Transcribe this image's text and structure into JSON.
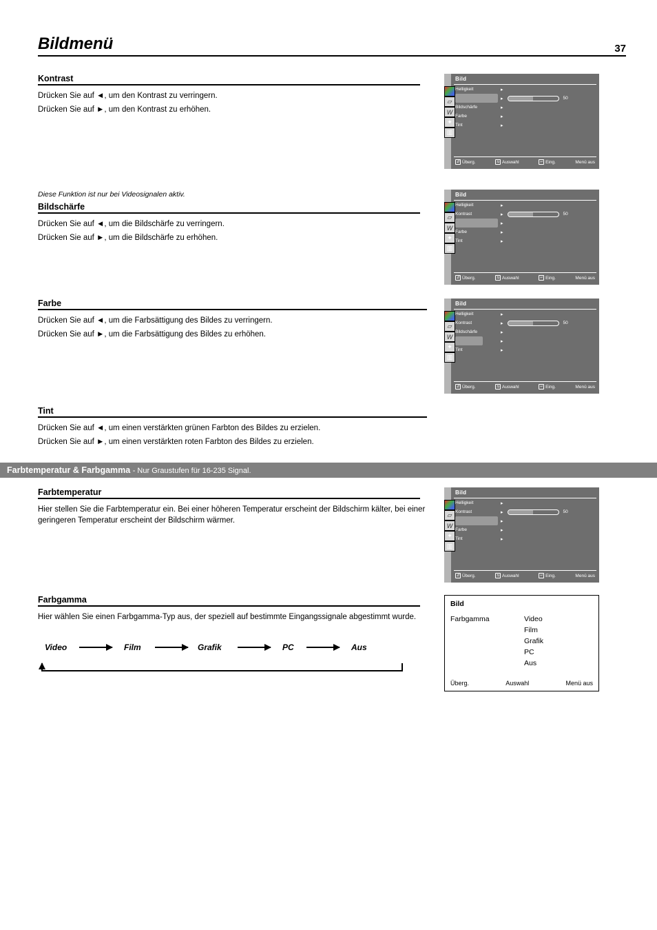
{
  "heading": "Bildmenü",
  "page_number": "37",
  "sections": {
    "kontrast": {
      "title": "Kontrast",
      "body": [
        "Drücken Sie auf ◄, um den Kontrast zu verringern.",
        "Drücken Sie auf ►, um den Kontrast zu erhöhen."
      ]
    },
    "bildschaerfe": {
      "title": "Bildschärfe",
      "caption": "Diese Funktion ist nur bei Videosignalen aktiv.",
      "body": [
        "Drücken Sie auf ◄, um die Bildschärfe zu verringern.",
        "Drücken Sie auf ►, um die Bildschärfe zu erhöhen."
      ]
    },
    "farbe": {
      "title": "Farbe",
      "body": [
        "Drücken Sie auf ◄, um die Farbsättigung des Bildes zu verringern.",
        "Drücken Sie auf ►, um die Farbsättigung des Bildes zu erhöhen."
      ]
    },
    "tint": {
      "title": "Tint",
      "body": [
        "Drücken Sie auf ◄, um einen verstärkten grünen Farbton des Bildes zu erzielen.",
        "Drücken Sie auf ►, um einen verstärkten roten Farbton des Bildes zu erzielen."
      ]
    },
    "farbnotiz": {
      "title": "Farbtemperatur & Farbgamma",
      "note": "- Nur Graustufen für 16-235 Signal."
    },
    "farbtemperatur": {
      "title": "Farbtemperatur",
      "body": [
        "Hier stellen Sie die Farbtemperatur ein. Bei einer höheren Temperatur erscheint der Bildschirm kälter, bei einer geringeren Temperatur erscheint der Bildschirm wärmer."
      ]
    },
    "farbgamma": {
      "title": "Farbgamma",
      "body": [
        "Hier wählen Sie einen Farbgamma-Typ aus, der speziell auf bestimmte Eingangssignale abgestimmt wurde."
      ]
    }
  },
  "cycle": [
    "Video",
    "Film",
    "Grafik",
    "PC",
    "Aus"
  ],
  "osd": {
    "header": "Bild",
    "rows": [
      "Helligkeit",
      "Kontrast",
      "Bildschärfe",
      "Farbe",
      "Tint"
    ],
    "kontrast_value": "50",
    "footer": [
      "Überg.",
      "Auswahl",
      "Eing.",
      "Menü aus"
    ]
  },
  "gamma": {
    "title": "Bild",
    "item": "Farbgamma",
    "values": [
      "Video",
      "Film",
      "Grafik",
      "PC",
      "Aus"
    ],
    "nav": [
      "Überg.",
      "Auswahl",
      "Menü aus"
    ]
  }
}
